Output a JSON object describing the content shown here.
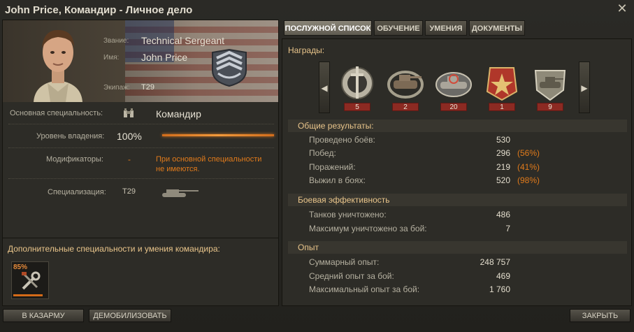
{
  "window": {
    "title": "John Price, Командир - Личное дело"
  },
  "profile": {
    "rank_label": "Звание:",
    "rank_value": "Technical Sergeant",
    "name_label": "Имя:",
    "name_value": "John Price",
    "crew_label": "Экипаж:",
    "crew_value": "T29"
  },
  "specialty": {
    "main_label": "Основная специальность:",
    "main_value": "Командир",
    "level_label": "Уровень владения:",
    "level_value": "100%",
    "level_fraction": 1.0,
    "modifiers_label": "Модификаторы:",
    "modifiers_value": "-",
    "modifiers_note": "При основной специальности не имеются.",
    "spec_label": "Специализация:",
    "spec_value": "T29"
  },
  "skills": {
    "title": "Дополнительные специальности и умения командира:",
    "items": [
      {
        "percent": "85%",
        "icon": "repair-tools-icon"
      }
    ]
  },
  "tabs": [
    "ПОСЛУЖНОЙ СПИСОК",
    "ОБУЧЕНИЕ",
    "УМЕНИЯ",
    "ДОКУМЕНТЫ"
  ],
  "awards": {
    "label": "Награды:",
    "items": [
      {
        "icon": "sword-medal-icon",
        "count": "5"
      },
      {
        "icon": "tank-wreath-medal-icon",
        "count": "2"
      },
      {
        "icon": "tank-target-medal-icon",
        "count": "20"
      },
      {
        "icon": "red-star-medal-icon",
        "count": "1"
      },
      {
        "icon": "tank-shield-medal-icon",
        "count": "9"
      }
    ]
  },
  "general": {
    "title": "Общие результаты:",
    "rows": [
      {
        "label": "Проведено боёв:",
        "value": "530",
        "pct": ""
      },
      {
        "label": "Побед:",
        "value": "296",
        "pct": "(56%)"
      },
      {
        "label": "Поражений:",
        "value": "219",
        "pct": "(41%)"
      },
      {
        "label": "Выжил в боях:",
        "value": "520",
        "pct": "(98%)"
      }
    ]
  },
  "combat": {
    "title": "Боевая эффективность",
    "rows": [
      {
        "label": "Танков уничтожено:",
        "value": "486"
      },
      {
        "label": "Максимум уничтожено за бой:",
        "value": "7"
      }
    ]
  },
  "experience": {
    "title": "Опыт",
    "rows": [
      {
        "label": "Суммарный опыт:",
        "value": "248 757"
      },
      {
        "label": "Средний опыт за бой:",
        "value": "469"
      },
      {
        "label": "Максимальный опыт за бой:",
        "value": "1 760"
      }
    ]
  },
  "buttons": {
    "barracks": "В КАЗАРМУ",
    "demobilize": "ДЕМОБИЛИЗОВАТЬ",
    "close": "ЗАКРЫТЬ"
  }
}
